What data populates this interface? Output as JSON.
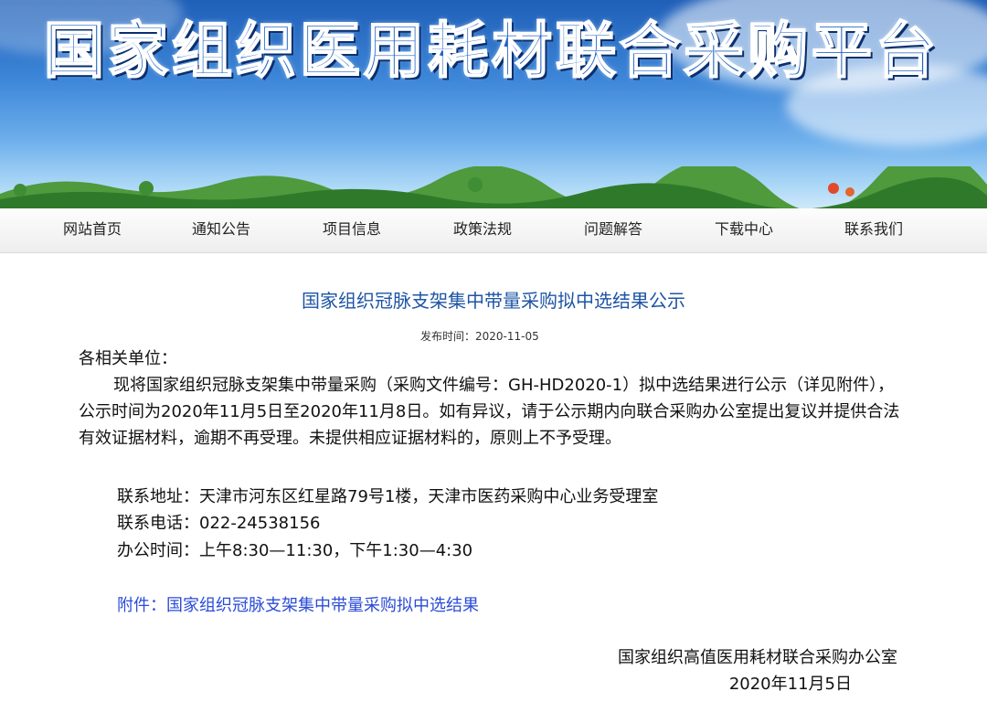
{
  "banner": {
    "title": "国家组织医用耗材联合采购平台"
  },
  "nav": {
    "items": [
      "网站首页",
      "通知公告",
      "项目信息",
      "政策法规",
      "问题解答",
      "下载中心",
      "联系我们"
    ]
  },
  "article": {
    "title": "国家组织冠脉支架集中带量采购拟中选结果公示",
    "publish_label": "发布时间：",
    "publish_date": "2020-11-05",
    "salutation": "各相关单位：",
    "paragraph": "现将国家组织冠脉支架集中带量采购（采购文件编号：GH-HD2020-1）拟中选结果进行公示（详见附件），公示时间为2020年11月5日至2020年11月8日。如有异议，请于公示期内向联合采购办公室提出复议并提供合法有效证据材料，逾期不再受理。未提供相应证据材料的，原则上不予受理。",
    "address": "联系地址：天津市河东区红星路79号1楼，天津市医药采购中心业务受理室",
    "phone": "联系电话：022-24538156",
    "hours": "办公时间：上午8:30—11:30，下午1:30—4:30",
    "attachment": "附件：国家组织冠脉支架集中带量采购拟中选结果",
    "signature_org": "国家组织高值医用耗材联合采购办公室",
    "signature_date": "2020年11月5日"
  },
  "colors": {
    "banner_sky": "#3d86d8",
    "title_blue": "#1e55a5",
    "link_blue": "#2b4bd8"
  }
}
